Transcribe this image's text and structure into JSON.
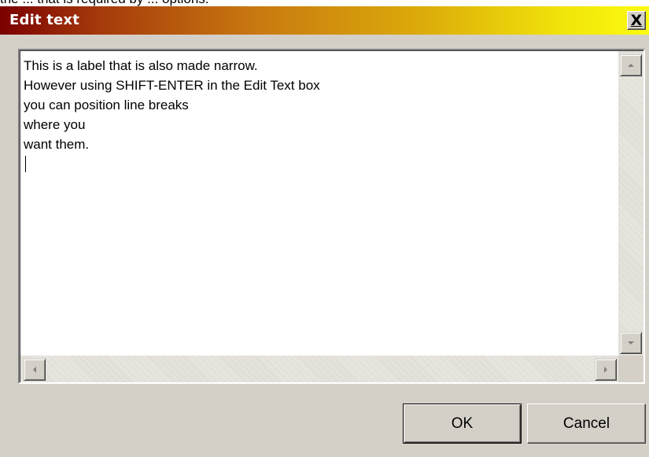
{
  "background_text": "the ... that is required by ... options.",
  "window": {
    "title": "Edit text",
    "close_label": "X"
  },
  "editor": {
    "lines": [
      "This is a label that is also made narrow.",
      "However using SHIFT-ENTER in the Edit Text box",
      "you can position line breaks",
      "where you",
      "want them."
    ]
  },
  "buttons": {
    "ok_label": "OK",
    "cancel_label": "Cancel"
  },
  "colors": {
    "title_gradient_start": "#7a0000",
    "title_gradient_end": "#fbfa10",
    "dialog_face": "#d4d0c8"
  },
  "icons": {
    "close": "close-icon",
    "scroll_up": "arrow-up-icon",
    "scroll_down": "arrow-down-icon",
    "scroll_left": "arrow-left-icon",
    "scroll_right": "arrow-right-icon"
  }
}
